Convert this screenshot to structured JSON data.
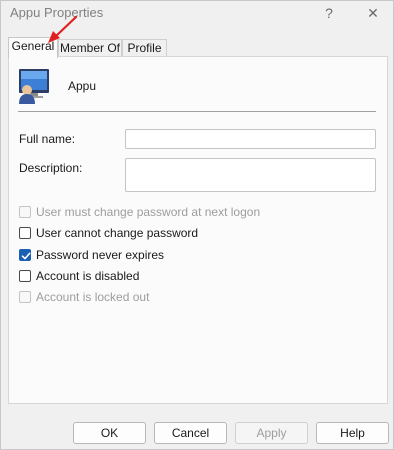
{
  "window": {
    "title": "Appu Properties",
    "help_glyph": "?",
    "close_glyph": "✕"
  },
  "tabs": [
    {
      "label": "General",
      "active": true
    },
    {
      "label": "Member Of",
      "active": false
    },
    {
      "label": "Profile",
      "active": false
    }
  ],
  "user": {
    "name": "Appu",
    "icon": "user-computer-icon"
  },
  "fields": {
    "full_name": {
      "label": "Full name:",
      "value": ""
    },
    "description": {
      "label": "Description:",
      "value": ""
    }
  },
  "options": [
    {
      "label": "User must change password at next logon",
      "checked": false,
      "enabled": false
    },
    {
      "label": "User cannot change password",
      "checked": false,
      "enabled": true
    },
    {
      "label": "Password never expires",
      "checked": true,
      "enabled": true
    },
    {
      "label": "Account is disabled",
      "checked": false,
      "enabled": true
    },
    {
      "label": "Account is locked out",
      "checked": false,
      "enabled": false
    }
  ],
  "buttons": {
    "ok": "OK",
    "cancel": "Cancel",
    "apply": "Apply",
    "help": "Help"
  },
  "colors": {
    "accent": "#1a5fb4",
    "annotation_arrow": "#e02020"
  }
}
